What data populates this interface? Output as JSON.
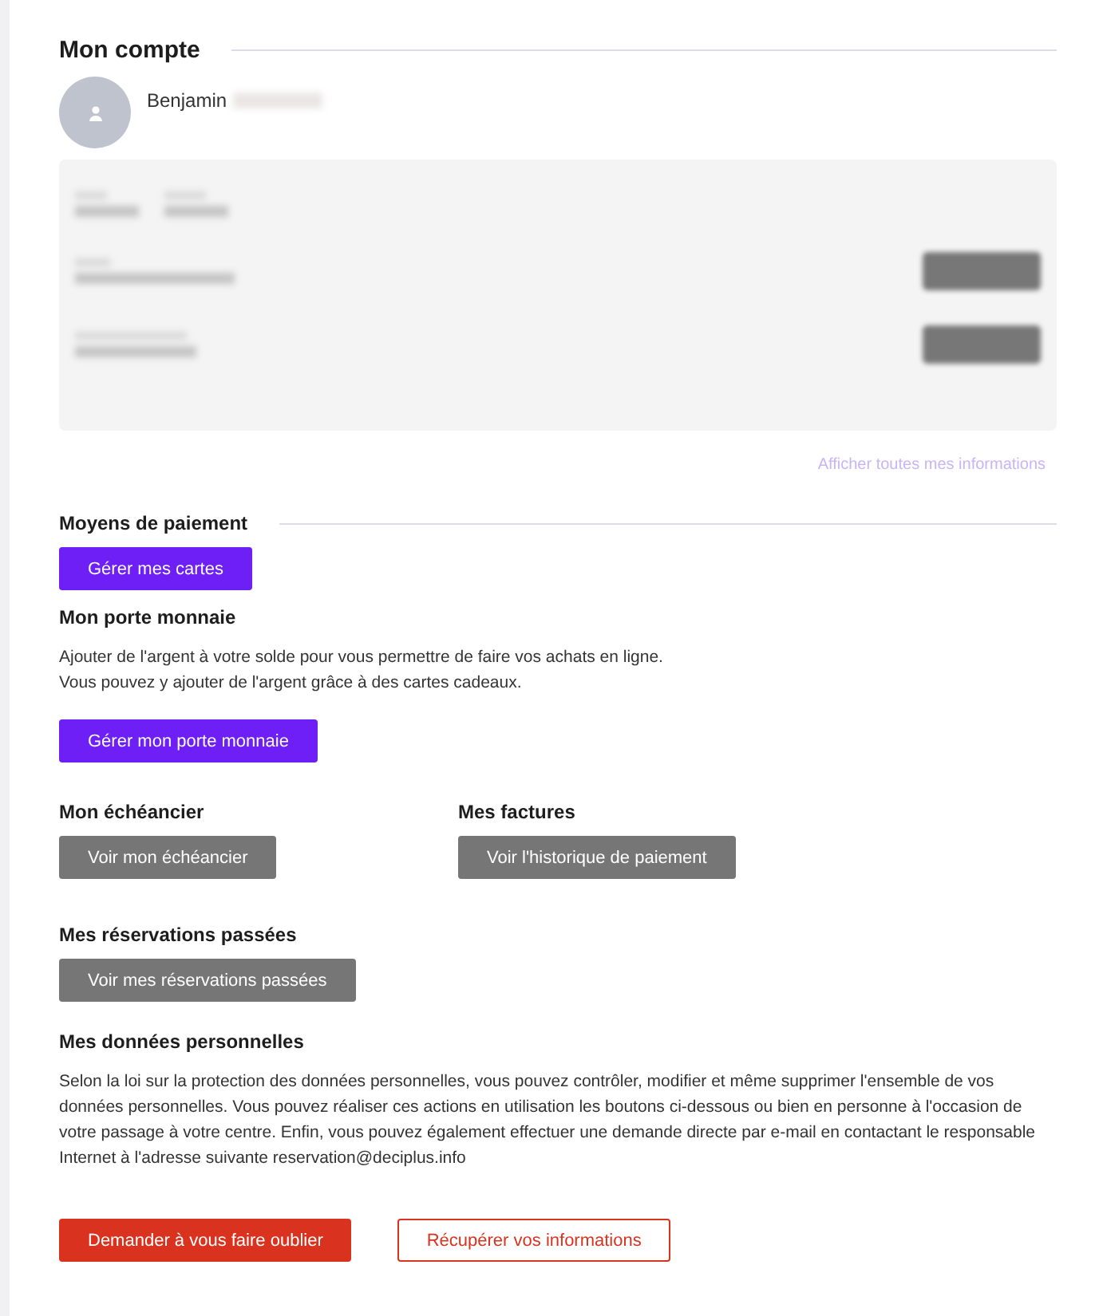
{
  "title": "Mon compte",
  "user": {
    "first_name": "Benjamin",
    "last_name_redacted": true
  },
  "info_link": "Afficher toutes mes informations",
  "payment": {
    "heading": "Moyens de paiement",
    "button": {
      "label": "Gérer mes cartes",
      "kind": "primary"
    }
  },
  "wallet": {
    "heading": "Mon porte monnaie",
    "lines": [
      "Ajouter de l'argent à votre solde pour vous permettre de faire vos achats en ligne.",
      "Vous pouvez y ajouter de l'argent grâce à des cartes cadeaux."
    ],
    "button": {
      "label": "Gérer mon porte monnaie",
      "kind": "primary"
    }
  },
  "columns": [
    {
      "heading": "Mon échéancier",
      "button": {
        "label": "Voir mon échéancier",
        "kind": "secondary"
      }
    },
    {
      "heading": "Mes factures",
      "button": {
        "label": "Voir l'historique de paiement",
        "kind": "secondary"
      }
    }
  ],
  "reservations": {
    "heading": "Mes réservations passées",
    "button": {
      "label": "Voir mes réservations passées",
      "kind": "secondary"
    }
  },
  "personal_data": {
    "heading": "Mes données personnelles",
    "text": "Selon la loi sur la protection des données personnelles, vous pouvez contrôler, modifier et même supprimer l'ensemble de vos données personnelles. Vous pouvez réaliser ces actions en utilisation les boutons ci-dessous ou bien en personne à l'occasion de votre passage à votre centre. Enfin, vous pouvez également effectuer une demande directe par e-mail en contactant le responsable Internet à l'adresse suivante reservation@deciplus.info",
    "buttons": [
      {
        "label": "Demander à vous faire oublier",
        "kind": "danger"
      },
      {
        "label": "Récupérer vos informations",
        "kind": "outline"
      }
    ]
  }
}
